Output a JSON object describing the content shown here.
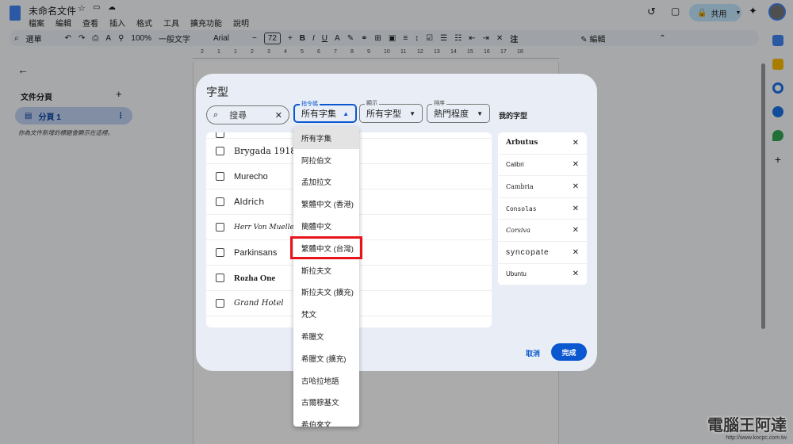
{
  "doc": {
    "title": "未命名文件",
    "menu": [
      "檔案",
      "編輯",
      "查看",
      "插入",
      "格式",
      "工具",
      "擴充功能",
      "說明"
    ],
    "share": "共用"
  },
  "toolbar": {
    "search": "選單",
    "zoom": "100%",
    "style": "一般文字",
    "font": "Arial",
    "size": "72",
    "mode": "編輯",
    "note": "注"
  },
  "ruler": [
    "2",
    "1",
    "1",
    "2",
    "3",
    "4",
    "5",
    "6",
    "7",
    "8",
    "9",
    "10",
    "11",
    "12",
    "13",
    "14",
    "15",
    "16",
    "17",
    "18"
  ],
  "sidebar": {
    "title": "文件分頁",
    "tab": "分頁 1",
    "hint": "你為文件新增的標題會顯示在這裡。"
  },
  "dialog": {
    "title": "字型",
    "search_placeholder": "搜尋",
    "script_label": "指令碼",
    "script_value": "所有字集",
    "show_label": "顯示",
    "show_value": "所有字型",
    "sort_label": "排序",
    "sort_value": "熱門程度",
    "my_fonts_title": "我的字型",
    "fonts": [
      "Brygada 1918",
      "Murecho",
      "Aldrich",
      "Herr Von Muellerhoff",
      "Parkinsans",
      "Rozha One",
      "Grand Hotel"
    ],
    "my_fonts": [
      "Arbutus",
      "Calibri",
      "Cambria",
      "Consolas",
      "Corsiva",
      "Syncopate",
      "Ubuntu"
    ],
    "cancel": "取消",
    "done": "完成"
  },
  "dropdown": [
    "所有字集",
    "阿拉伯文",
    "孟加拉文",
    "繁體中文 (香港)",
    "簡體中文",
    "繁體中文 (台灣)",
    "斯拉夫文",
    "斯拉夫文 (擴充)",
    "梵文",
    "希臘文",
    "希臘文 (擴充)",
    "古哈拉地語",
    "古爾穆基文",
    "希伯來文"
  ],
  "watermark": {
    "name": "電腦王阿達",
    "url": "http://www.kocpc.com.tw"
  },
  "colors": {
    "accent": "#0b57d0",
    "highlight": "#e8141b"
  }
}
